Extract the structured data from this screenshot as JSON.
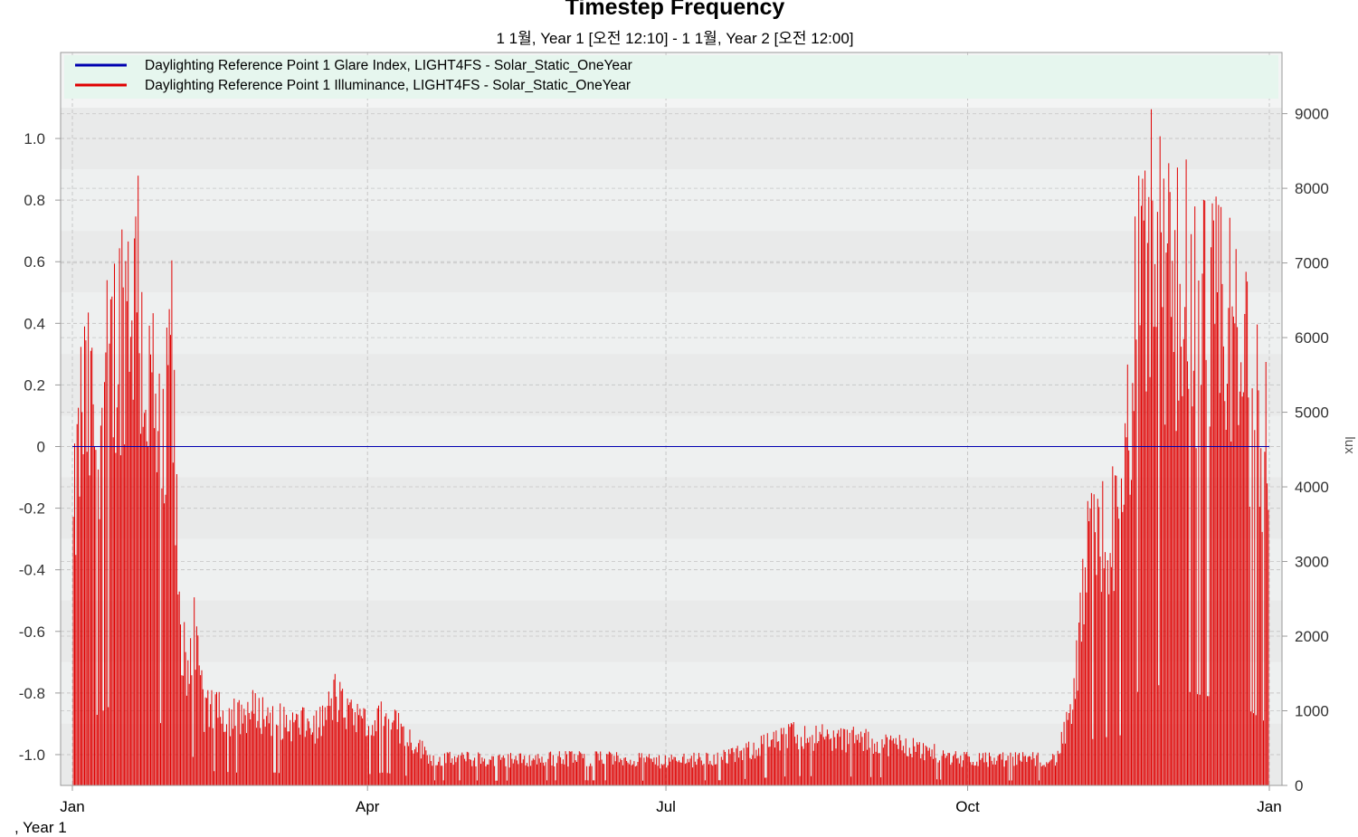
{
  "title": "Timestep Frequency",
  "subtitle": "1 1월, Year 1 [오전 12:10] - 1 1월, Year 2 [오전 12:00]",
  "footer_label": ", Year 1",
  "colors": {
    "glare": "#0000b0",
    "illuminance": "#e00000",
    "legend_bg": "#e6f6ee",
    "band_dark": "#e9eaea",
    "band_light": "#eef0f0"
  },
  "chart_data": {
    "type": "line",
    "x_tick_labels": [
      "Jan",
      "Apr",
      "Jul",
      "Oct",
      "Jan"
    ],
    "x_tick_days": [
      0,
      90,
      181,
      273,
      365
    ],
    "xlim": [
      0,
      365
    ],
    "left_axis": {
      "label": "",
      "ylim": [
        -1.1,
        1.1
      ],
      "tick_values": [
        1.0,
        0.8,
        0.6,
        0.4,
        0.2,
        0,
        -0.2,
        -0.4,
        -0.6,
        -0.8,
        -1.0
      ],
      "tick_labels": [
        "1.0",
        "0.8",
        "0.6",
        "0.4",
        "0.2",
        "0",
        "-0.2",
        "-0.4",
        "-0.6",
        "-0.8",
        "-1.0"
      ]
    },
    "right_axis": {
      "label": "lux",
      "ylim": [
        0,
        9650
      ],
      "tick_values": [
        9000,
        8000,
        7000,
        6000,
        5000,
        4000,
        3000,
        2000,
        1000,
        0
      ],
      "tick_labels": [
        "9000",
        "8000",
        "7000",
        "6000",
        "5000",
        "4000",
        "3000",
        "2000",
        "1000",
        "0"
      ]
    },
    "grid": true,
    "legend_position": "top",
    "series": [
      {
        "name": "Daylighting Reference Point 1 Glare Index, LIGHT4FS - Solar_Static_OneYear",
        "axis": "left",
        "constant_value": 0
      },
      {
        "name": "Daylighting Reference Point 1 Illuminance, LIGHT4FS - Solar_Static_OneYear",
        "axis": "right",
        "envelope_days": [
          0,
          3,
          7,
          12,
          14,
          16,
          18,
          20,
          22,
          25,
          28,
          30,
          33,
          35,
          37,
          40,
          45,
          50,
          55,
          60,
          65,
          70,
          75,
          80,
          85,
          90,
          95,
          100,
          110,
          120,
          130,
          150,
          170,
          180,
          200,
          220,
          240,
          250,
          260,
          270,
          280,
          300,
          305,
          310,
          320,
          325,
          330,
          335,
          340,
          345,
          350,
          355,
          360,
          362,
          365
        ],
        "envelope_peaks": [
          4000,
          6600,
          6200,
          7200,
          7800,
          8300,
          8700,
          8200,
          7200,
          6200,
          5200,
          7600,
          2300,
          2100,
          2600,
          1300,
          1250,
          1150,
          1300,
          1200,
          1050,
          1050,
          1000,
          1500,
          1150,
          1000,
          1150,
          950,
          450,
          450,
          430,
          460,
          450,
          400,
          480,
          850,
          780,
          700,
          600,
          450,
          440,
          450,
          1300,
          4100,
          4500,
          8500,
          9200,
          8200,
          8400,
          8000,
          7900,
          7400,
          6500,
          6000,
          5500
        ]
      }
    ]
  }
}
